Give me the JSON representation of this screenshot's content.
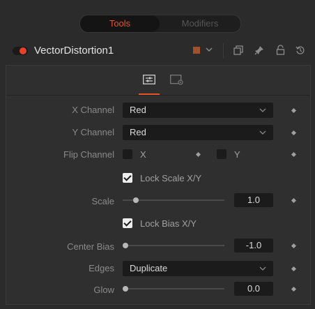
{
  "tabs": {
    "tools": "Tools",
    "modifiers": "Modifiers"
  },
  "header": {
    "node_name": "VectorDistortion1",
    "swatch_color": "#a0522d"
  },
  "params": {
    "x_channel": {
      "label": "X Channel",
      "value": "Red"
    },
    "y_channel": {
      "label": "Y Channel",
      "value": "Red"
    },
    "flip_channel": {
      "label": "Flip Channel",
      "x_label": "X",
      "y_label": "Y",
      "x_checked": false,
      "y_checked": false
    },
    "lock_scale": {
      "label": "Lock Scale X/Y",
      "checked": true
    },
    "scale": {
      "label": "Scale",
      "value": "1.0",
      "slider_fraction": 0.1
    },
    "lock_bias": {
      "label": "Lock Bias X/Y",
      "checked": true
    },
    "center_bias": {
      "label": "Center Bias",
      "value": "-1.0",
      "slider_fraction": 0.0
    },
    "edges": {
      "label": "Edges",
      "value": "Duplicate"
    },
    "glow": {
      "label": "Glow",
      "value": "0.0",
      "slider_fraction": 0.0
    }
  },
  "colors": {
    "accent": "#e8532a",
    "active_dot": "#e8432a"
  }
}
